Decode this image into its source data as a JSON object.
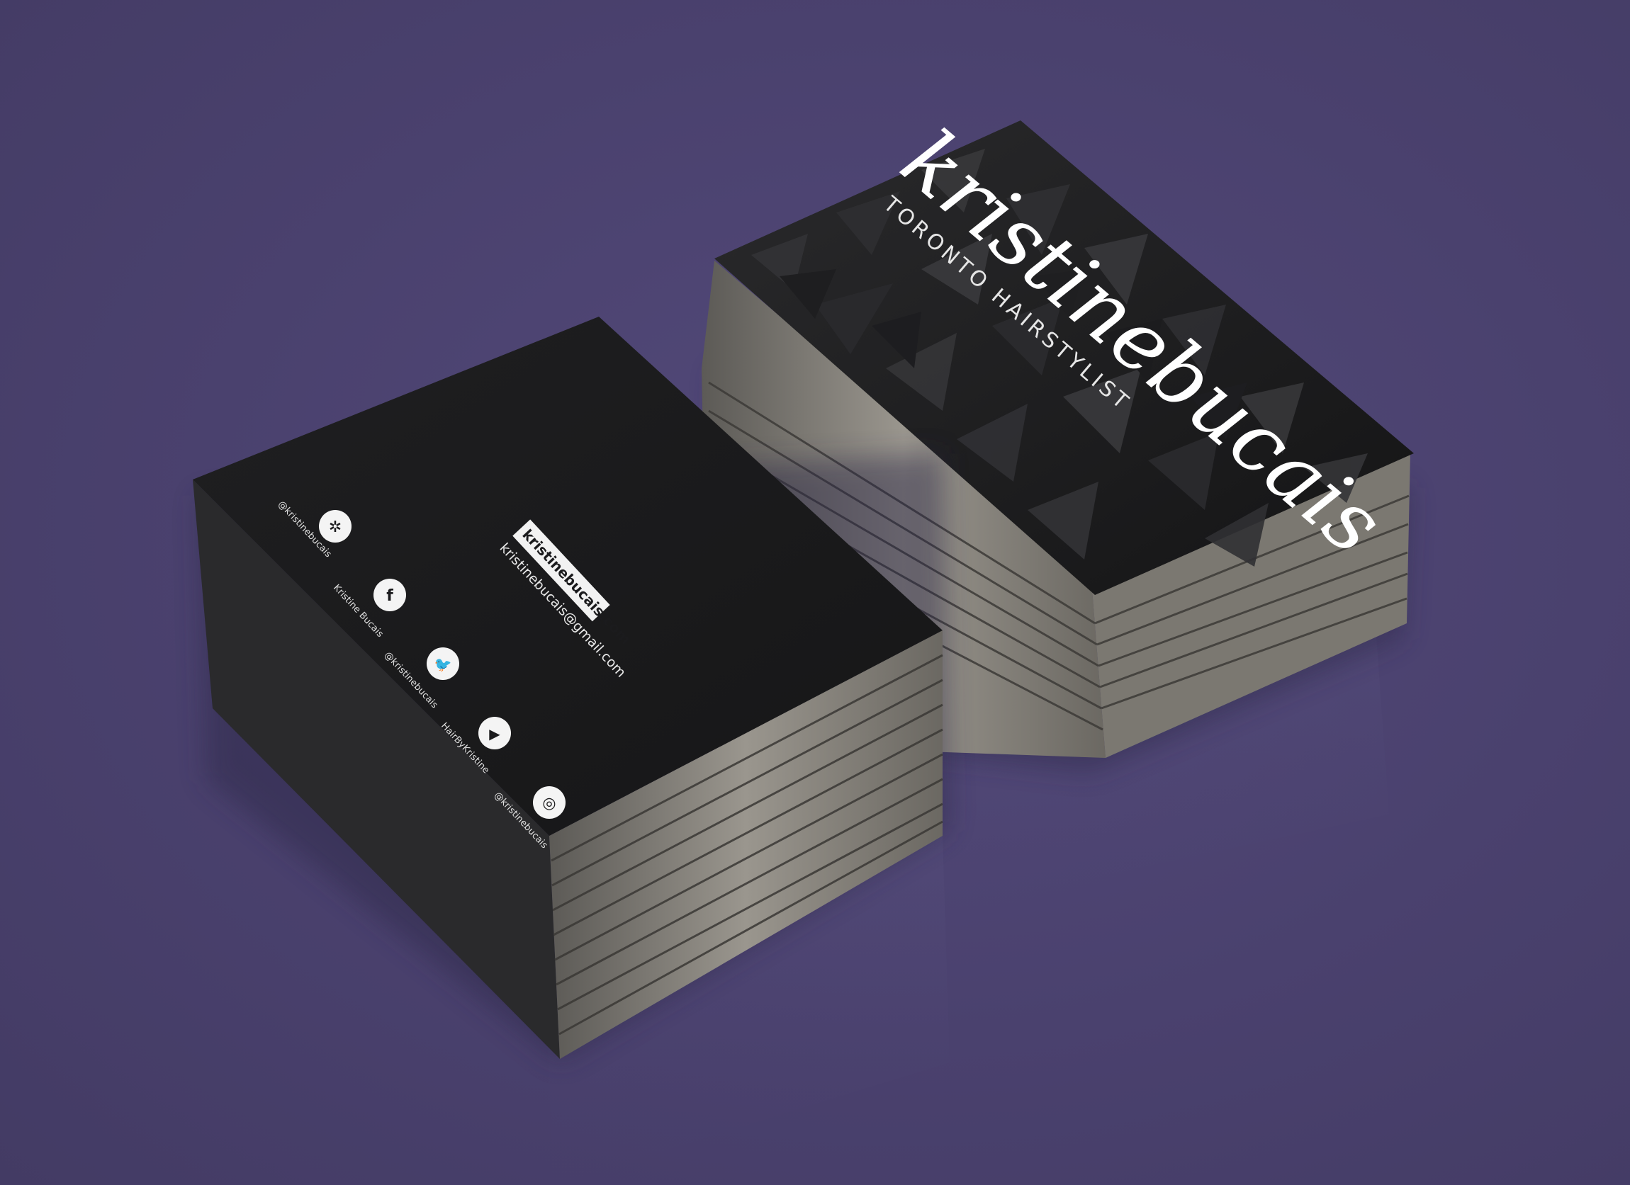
{
  "scene": {
    "background_color": "#4b4270",
    "card_color": "#1b1b1d",
    "card_edge_color": "#8a8780"
  },
  "back_card": {
    "website": "kristinebucais.com",
    "email": "kristinebucais@gmail.com",
    "socials": [
      {
        "icon": "yelp-icon",
        "glyph": "✲",
        "handle": "@kristinebucais"
      },
      {
        "icon": "facebook-icon",
        "glyph": "f",
        "handle": "Kristine Bucais"
      },
      {
        "icon": "twitter-icon",
        "glyph": "🐦",
        "handle": "@kristinebucais"
      },
      {
        "icon": "youtube-icon",
        "glyph": "▶",
        "handle": "HairByKristine"
      },
      {
        "icon": "instagram-icon",
        "glyph": "◎",
        "handle": "@kristinebucais"
      }
    ]
  },
  "front_card": {
    "logo_name": "kristinebucais",
    "tagline": "TORONTO HAIRSTYLIST"
  }
}
